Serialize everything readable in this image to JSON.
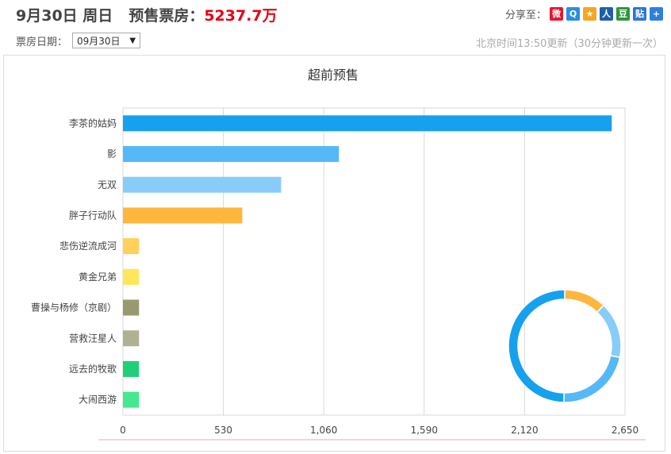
{
  "header": {
    "date": "9月30日",
    "weekday": "周日",
    "presale_label": "预售票房：",
    "presale_amount": "5237.7万"
  },
  "share": {
    "label": "分享至：",
    "icons": [
      {
        "name": "weibo-icon",
        "color": "#e6162d",
        "glyph": "微"
      },
      {
        "name": "qzone-icon",
        "color": "#2b8de3",
        "glyph": "Q"
      },
      {
        "name": "qq-star-icon",
        "color": "#f5a623",
        "glyph": "★"
      },
      {
        "name": "renren-icon",
        "color": "#1f5fa8",
        "glyph": "人"
      },
      {
        "name": "douban-icon",
        "color": "#2e963d",
        "glyph": "豆"
      },
      {
        "name": "tieba-icon",
        "color": "#2d75d6",
        "glyph": "贴"
      },
      {
        "name": "more-share-icon",
        "color": "#2f7fdb",
        "glyph": "+"
      }
    ]
  },
  "date_picker": {
    "label": "票房日期：",
    "value": "09月30日"
  },
  "update_info": "北京时间13:50更新（30分钟更新一次）",
  "chart_data": {
    "type": "bar",
    "orientation": "horizontal",
    "title": "超前预售",
    "categories": [
      "李茶的姑妈",
      "影",
      "无双",
      "胖子行动队",
      "悲伤逆流成河",
      "黄金兄弟",
      "曹操与杨修（京剧）",
      "营救汪星人",
      "远去的牧歌",
      "大闹西游"
    ],
    "values": [
      2580,
      1140,
      835,
      630,
      85,
      85,
      85,
      85,
      85,
      85
    ],
    "colors": [
      "#15a1ee",
      "#55b8f7",
      "#88cdfa",
      "#ffb63d",
      "#ffd05a",
      "#ffe65a",
      "#9a9870",
      "#b0b094",
      "#22cf79",
      "#44e890"
    ],
    "xlim": [
      0,
      2650
    ],
    "xticks": [
      0,
      530,
      1060,
      1590,
      2120,
      2650
    ],
    "xtick_labels": [
      "0",
      "530",
      "1,060",
      "1,590",
      "2,120",
      "2,650"
    ],
    "grid": true,
    "donut": {
      "values": [
        2580,
        1140,
        835,
        630
      ],
      "colors": [
        "#15a1ee",
        "#55b8f7",
        "#88cdfa",
        "#ffb63d"
      ]
    }
  }
}
